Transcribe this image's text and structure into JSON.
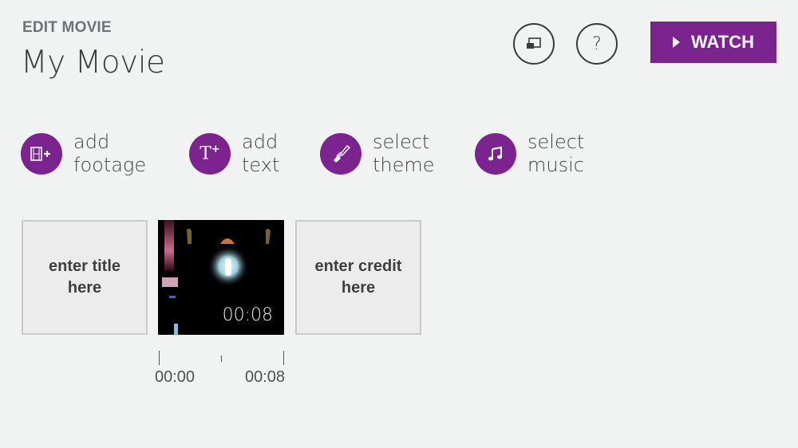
{
  "header": {
    "kicker": "EDIT MOVIE",
    "title": "My Movie"
  },
  "toolbar": {
    "cast_icon": "cast-to-device-icon",
    "help_label": "?",
    "watch_label": "WATCH",
    "accent_color": "#7b2490"
  },
  "actions": [
    {
      "line1": "add",
      "line2": "footage",
      "icon": "film-plus-icon"
    },
    {
      "line1": "add",
      "line2": "text",
      "icon": "text-plus-icon"
    },
    {
      "line1": "select",
      "line2": "theme",
      "icon": "paintbrush-icon"
    },
    {
      "line1": "select",
      "line2": "music",
      "icon": "music-note-icon"
    }
  ],
  "storyboard": {
    "title_card": {
      "line1": "enter title",
      "line2": "here"
    },
    "clip": {
      "duration": "00:08"
    },
    "credit_card": {
      "line1": "enter credit",
      "line2": "here"
    }
  },
  "timeline": {
    "start": "00:00",
    "end": "00:08"
  }
}
